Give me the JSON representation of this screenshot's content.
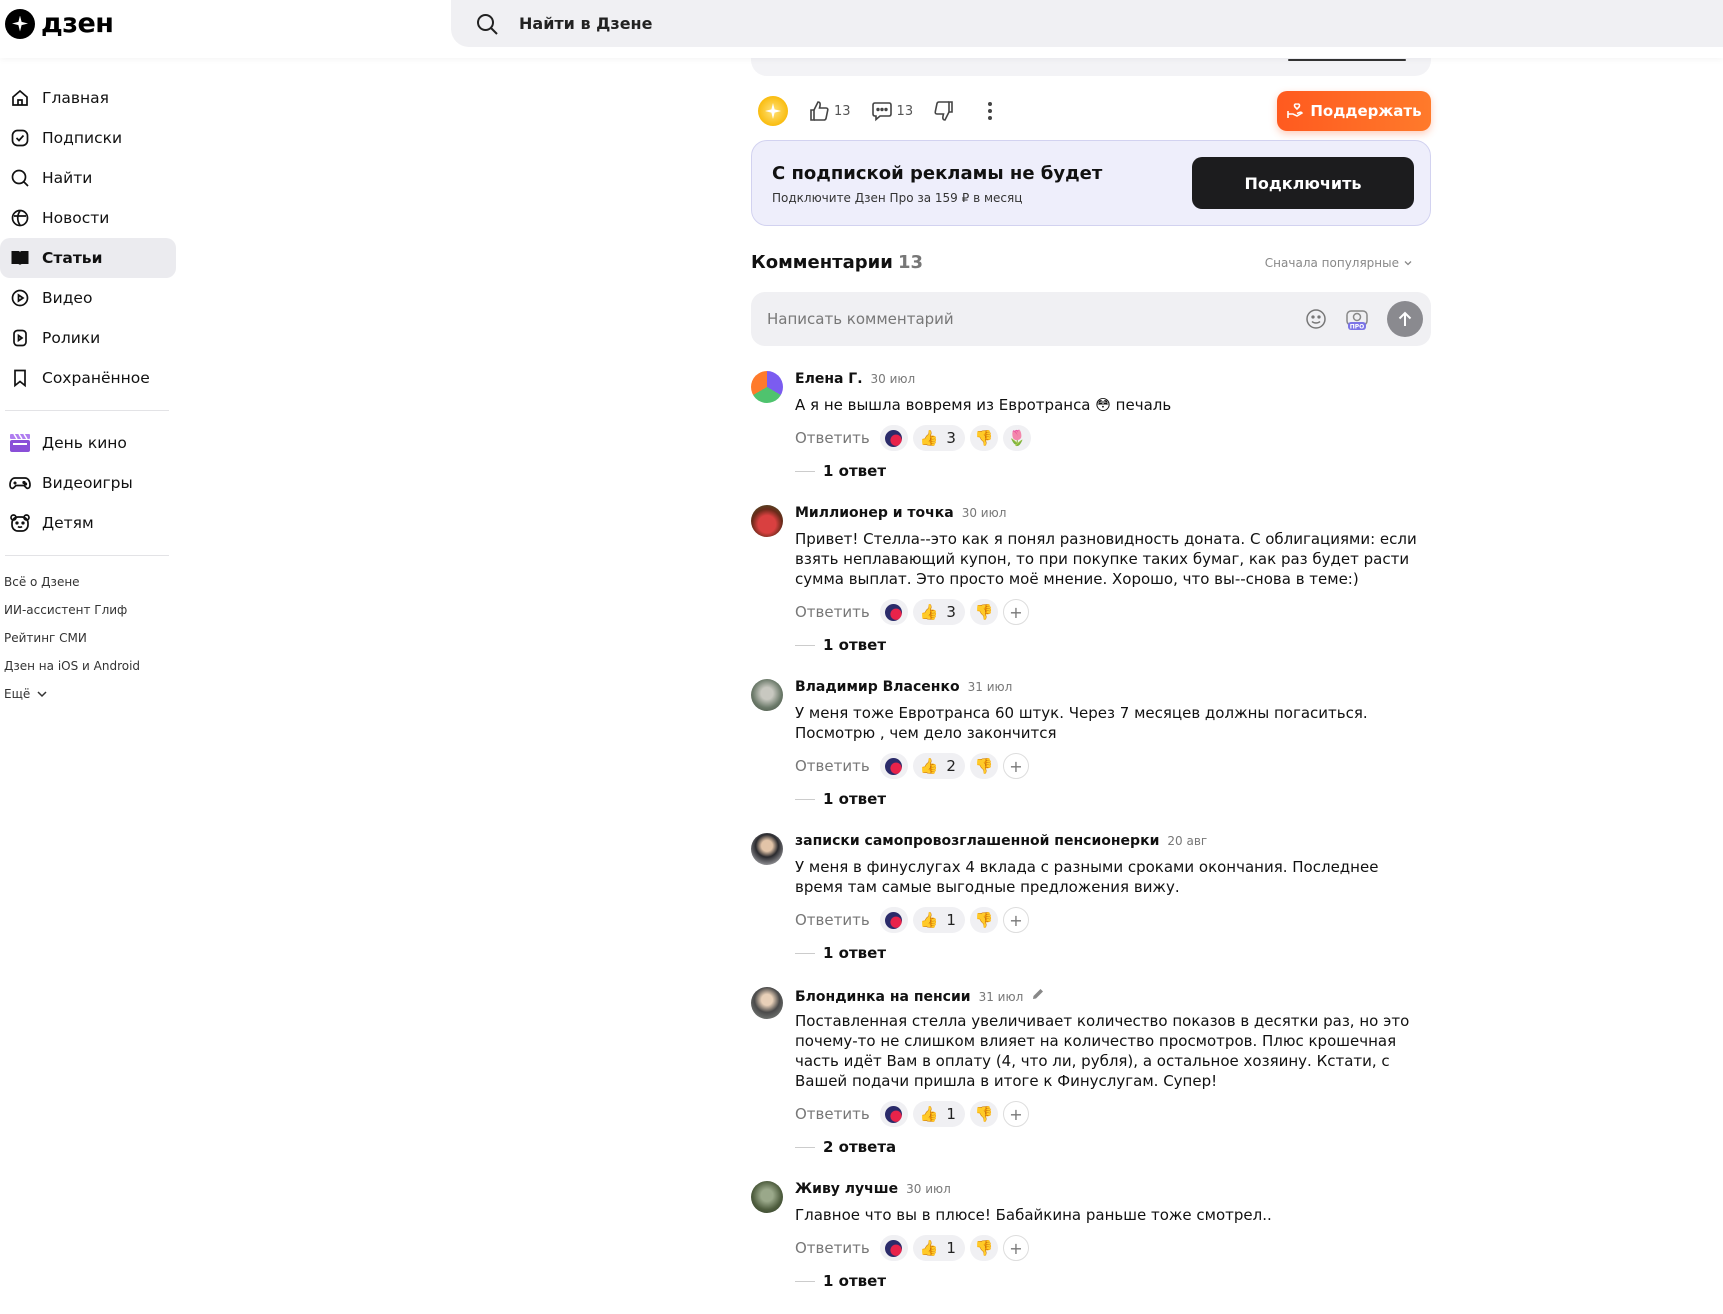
{
  "header": {
    "logo_text": "дзен",
    "search_placeholder": "Найти в Дзене"
  },
  "sidebar": {
    "items": [
      {
        "label": "Главная",
        "icon": "home-icon"
      },
      {
        "label": "Подписки",
        "icon": "subscriptions-icon"
      },
      {
        "label": "Найти",
        "icon": "search-icon"
      },
      {
        "label": "Новости",
        "icon": "news-icon"
      },
      {
        "label": "Статьи",
        "icon": "articles-icon",
        "active": true
      },
      {
        "label": "Видео",
        "icon": "video-icon"
      },
      {
        "label": "Ролики",
        "icon": "shorts-icon"
      },
      {
        "label": "Сохранённое",
        "icon": "bookmark-icon"
      }
    ],
    "special_items": [
      {
        "label": "День кино",
        "icon": "clapperboard-icon"
      },
      {
        "label": "Видеоигры",
        "icon": "gamepad-icon"
      },
      {
        "label": "Детям",
        "icon": "kids-bear-icon"
      }
    ],
    "footer_links": [
      "Всё о Дзене",
      "ИИ-ассистент Глиф",
      "Рейтинг СМИ",
      "Дзен на iOS и Android",
      "Ещё"
    ]
  },
  "article_actions": {
    "likes": "13",
    "comments": "13",
    "support_label": "Поддержать"
  },
  "promo": {
    "title": "С подпиской рекламы не будет",
    "subtitle": "Подключите Дзен Про за 159 ₽ в месяц",
    "button": "Подключить"
  },
  "comments": {
    "title": "Комментарии",
    "count": "13",
    "sort_label": "Сначала популярные",
    "compose_placeholder": "Написать комментарий",
    "reply_label": "Ответить",
    "list": [
      {
        "author": "Елена Г.",
        "date": "30 июл",
        "text": "А я не вышла вовремя из Евротранса 😳 печаль",
        "likes": "3",
        "replies": "1 ответ"
      },
      {
        "author": "Миллионер и точка",
        "date": "30 июл",
        "text": "Привет! Стелла--это как я понял разновидность доната. С облигациями: если взять неплавающий купон, то при покупке таких бумаг, как раз будет расти сумма выплат. Это просто моё мнение. Хорошо, что вы--снова в теме:)",
        "likes": "3",
        "replies": "1 ответ"
      },
      {
        "author": "Владимир Власенко",
        "date": "31 июл",
        "text": "У меня тоже Евротранса 60 штук. Через 7 месяцев должны погаситься. Посмотрю , чем дело закончится",
        "likes": "2",
        "replies": "1 ответ"
      },
      {
        "author": "записки самопровозглашенной пенсионерки",
        "date": "20 авг",
        "text": "У меня в финуслугах 4 вклада с разными сроками окончания. Последнее время там самые выгодные предложения вижу.",
        "likes": "1",
        "replies": "1 ответ"
      },
      {
        "author": "Блондинка на пенсии",
        "date": "31 июл",
        "text": "Поставленная стелла увеличивает количество показов в десятки раз, но это почему-то не слишком влияет на количество просмотров. Плюс крошечная часть идёт Вам в оплату (4, что ли, рубля), а остальное хозяину. Кстати, с Вашей подачи пришла в итоге к Финуслугам. Супер!",
        "likes": "1",
        "replies": "2 ответа"
      },
      {
        "author": "Живу лучше",
        "date": "30 июл",
        "text": "Главное что вы в плюсе! Бабайкина раньше тоже смотрел..",
        "likes": "1",
        "replies": "1 ответ"
      }
    ]
  },
  "colors": {
    "accent_orange": "#ff5a1f",
    "promo_bg": "#eeeefb",
    "active_nav_bg": "#ebebef"
  }
}
